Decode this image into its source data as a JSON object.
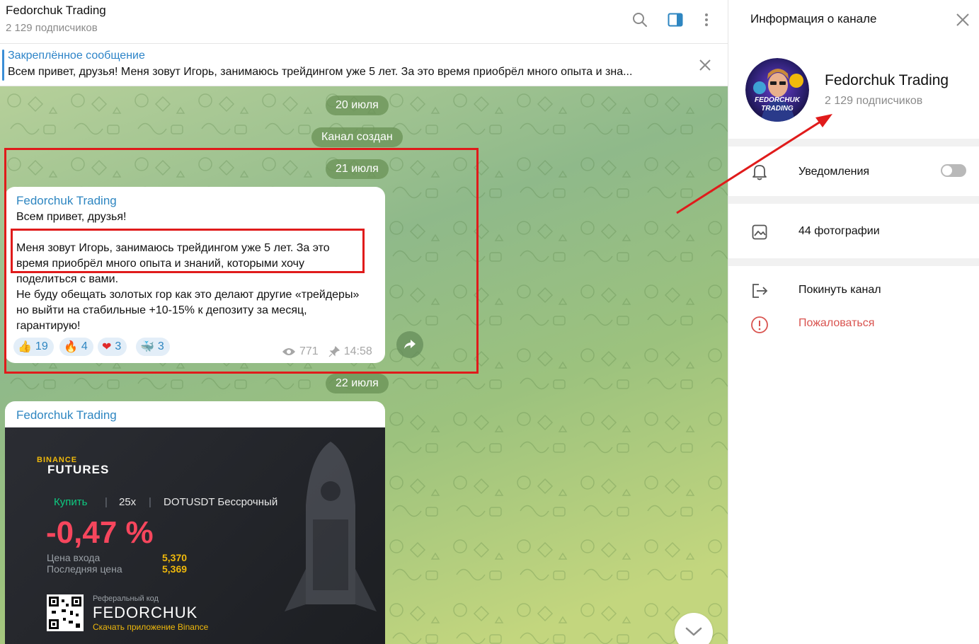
{
  "chat": {
    "title": "Fedorchuk Trading",
    "subtitle": "2 129 подписчиков"
  },
  "header_icons": [
    "search-icon",
    "sidebar-toggle-icon",
    "more-vertical-icon"
  ],
  "pinned": {
    "title": "Закреплённое сообщение",
    "text": "Всем привет, друзья!   Меня зовут Игорь, занимаюсь трейдингом уже 5 лет. За это время приобрёл много опыта и зна..."
  },
  "dates": {
    "d1": "20 июля",
    "created": "Канал создан",
    "d2": "21 июля",
    "d3": "22 июля"
  },
  "message1": {
    "author": "Fedorchuk Trading",
    "line1": "Всем привет, друзья!",
    "para2_l1": "Меня зовут Игорь, занимаюсь трейдингом уже 5 лет. За это",
    "para2_l2": "время приобрёл много опыта и знаний, которыми хочу",
    "para2_l3": "поделиться с вами.",
    "para2_l4": "Не буду обещать золотых гор как это делают другие «трейдеры»",
    "para2_l5": "но выйти на стабильные +10-15% к депозиту за месяц,",
    "para2_l6": "гарантирую!",
    "reactions": [
      {
        "emoji": "👍",
        "count": "19"
      },
      {
        "emoji": "🔥",
        "count": "4"
      },
      {
        "emoji": "❤",
        "count": "3"
      },
      {
        "emoji": "🐳",
        "count": "3"
      }
    ],
    "views": "771",
    "time": "14:58"
  },
  "message2": {
    "author": "Fedorchuk Trading",
    "card": {
      "brand": "BINANCE",
      "product": "FUTURES",
      "side": "Купить",
      "leverage": "25x",
      "pair": "DOTUSDT Бессрочный",
      "pnl": "-0,47 %",
      "entry_label": "Цена входа",
      "entry_value": "5,370",
      "last_label": "Последняя цена",
      "last_value": "5,369",
      "ref_label": "Реферальный код",
      "ref_code": "FEDORCHUK",
      "download": "Скачать приложение Binance"
    }
  },
  "panel": {
    "title": "Информация о канале",
    "channel_name": "Fedorchuk Trading",
    "channel_sub": "2 129 подписчиков",
    "avatar_text_1": "FEDORCHUK",
    "avatar_text_2": "TRADING",
    "notifications": "Уведомления",
    "notifications_on": false,
    "photos": "44 фотографии",
    "leave": "Покинуть канал",
    "report": "Пожаловаться"
  },
  "colors": {
    "accent": "#2e86c1",
    "annotation": "#e01b1b",
    "report": "#d9534f",
    "loss": "#f6465d",
    "binance": "#f0b90b"
  }
}
